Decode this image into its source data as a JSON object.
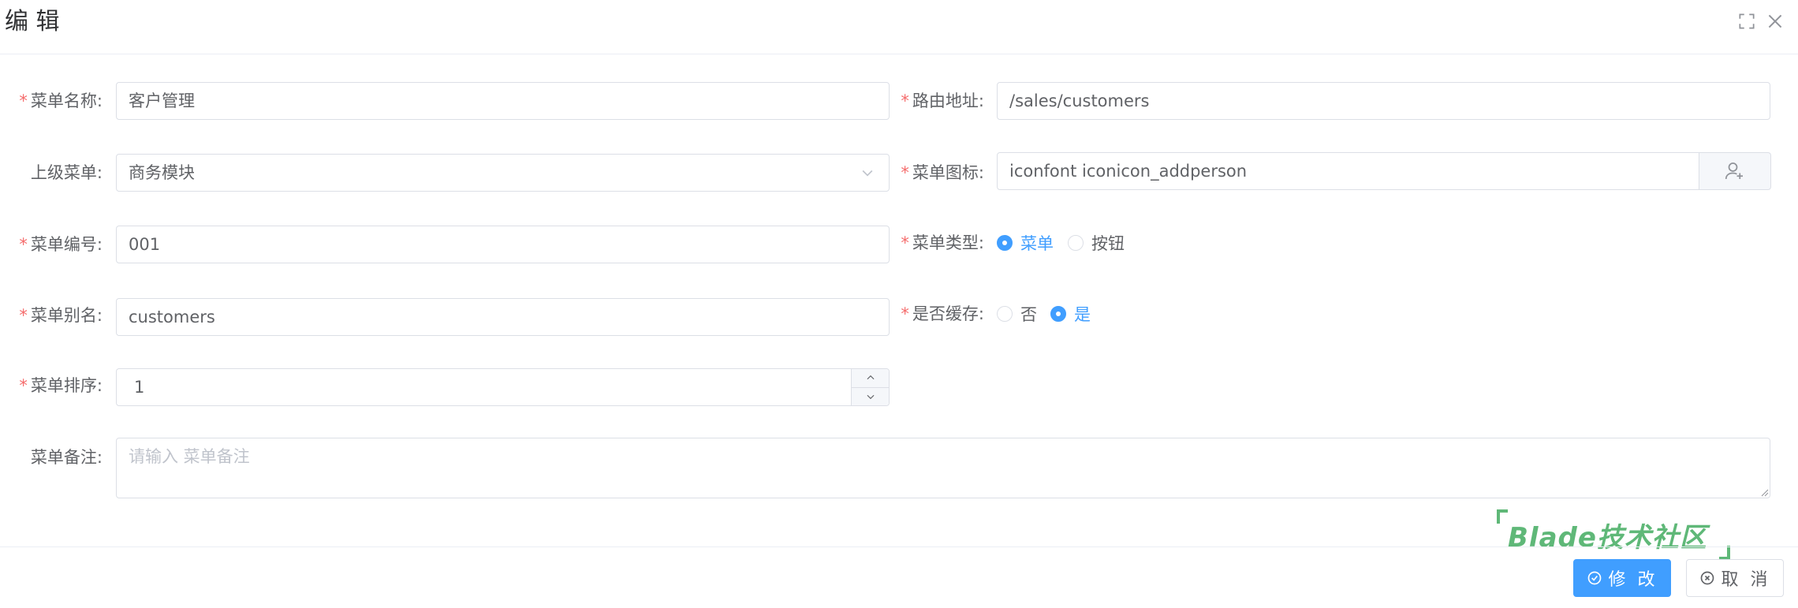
{
  "dialog": {
    "title": "编 辑"
  },
  "form": {
    "menu_name": {
      "label": "菜单名称:",
      "value": "客户管理"
    },
    "route": {
      "label": "路由地址:",
      "value": "/sales/customers"
    },
    "parent": {
      "label": "上级菜单:",
      "value": "商务模块"
    },
    "icon": {
      "label": "菜单图标:",
      "value": "iconfont iconicon_addperson"
    },
    "code": {
      "label": "菜单编号:",
      "value": "001"
    },
    "type": {
      "label": "菜单类型:",
      "options": [
        "菜单",
        "按钮"
      ],
      "selected": "菜单"
    },
    "alias": {
      "label": "菜单别名:",
      "value": "customers"
    },
    "cache": {
      "label": "是否缓存:",
      "options": [
        "否",
        "是"
      ],
      "selected": "是"
    },
    "sort": {
      "label": "菜单排序:",
      "value": "1"
    },
    "remark": {
      "label": "菜单备注:",
      "placeholder": "请输入 菜单备注"
    }
  },
  "watermark": {
    "text": "Blade技术社区"
  },
  "footer": {
    "submit_label": "修 改",
    "cancel_label": "取 消"
  },
  "colors": {
    "primary": "#409eff",
    "required": "#f56c6c"
  }
}
